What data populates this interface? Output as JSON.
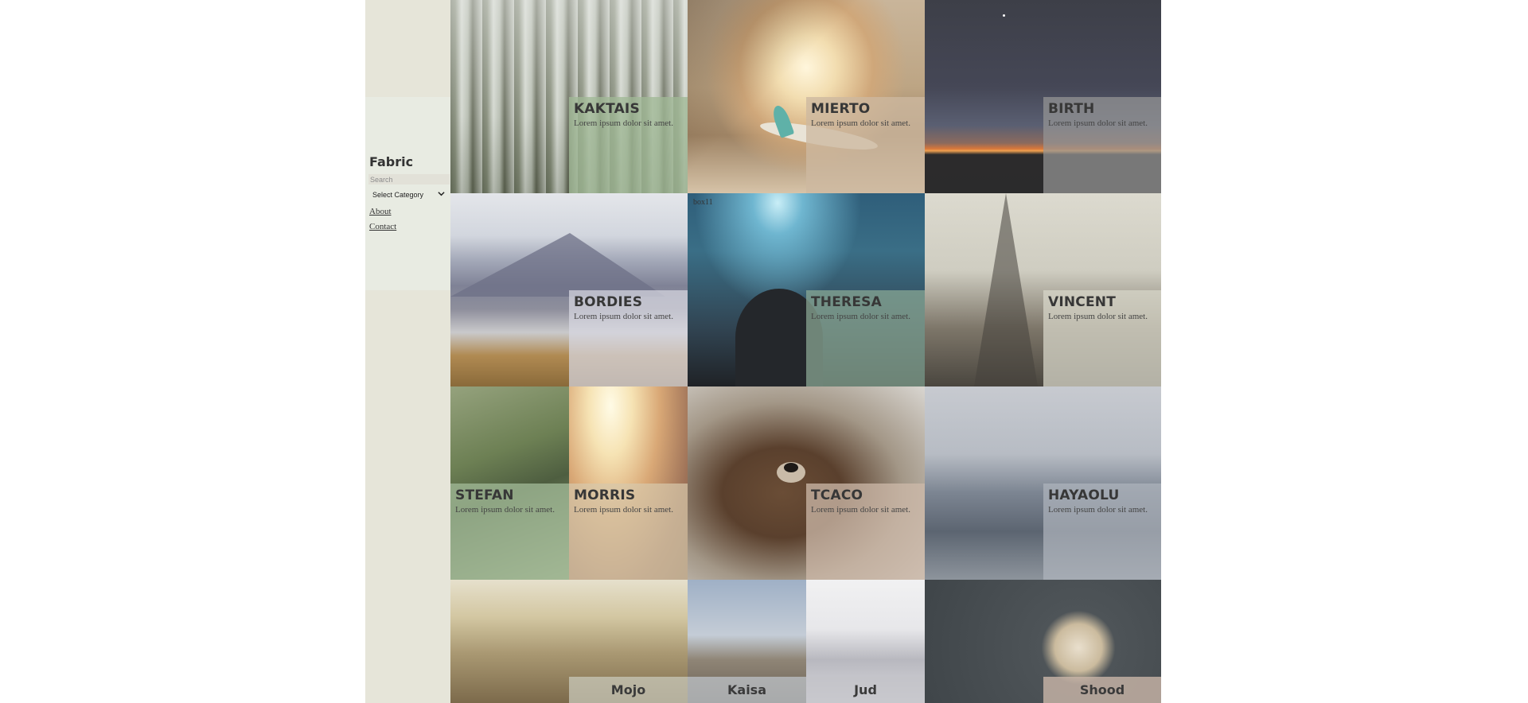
{
  "sidebar": {
    "brand": "Fabric",
    "search_placeholder": "Search",
    "category_selected": "Select Category",
    "nav": [
      "About",
      "Contact"
    ]
  },
  "tiles": [
    {
      "name": "KAKTAIS",
      "desc": "Lorem ipsum dolor sit amet."
    },
    {
      "name": "MIERTO",
      "desc": "Lorem ipsum dolor sit amet."
    },
    {
      "name": "BIRTH",
      "desc": "Lorem ipsum dolor sit amet."
    },
    {
      "name": "BORDIES",
      "desc": "Lorem ipsum dolor sit amet."
    },
    {
      "name": "THERESA",
      "desc": "Lorem ipsum dolor sit amet.",
      "box_label": "box11"
    },
    {
      "name": "VINCENT",
      "desc": "Lorem ipsum dolor sit amet."
    },
    {
      "name": "STEFAN",
      "desc": "Lorem ipsum dolor sit amet."
    },
    {
      "name": "MORRIS",
      "desc": "Lorem ipsum dolor sit amet."
    },
    {
      "name": "TCACO",
      "desc": "Lorem ipsum dolor sit amet."
    },
    {
      "name": "HAYAOLU",
      "desc": "Lorem ipsum dolor sit amet."
    }
  ],
  "bottom_tiles": [
    "Mojo",
    "Kaisa",
    "Jud",
    "Shood"
  ],
  "colors": {
    "sidebar_bg": "#e6e5d9",
    "panel_bg": "#e8ebe2",
    "caption_green": "#9cb596",
    "caption_tan": "#c9b8a8",
    "caption_grey": "#b0b0b0"
  }
}
